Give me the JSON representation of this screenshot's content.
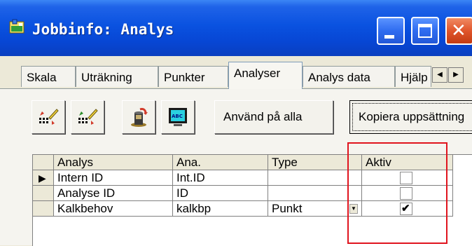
{
  "window": {
    "title": "Jobbinfo: Analys",
    "icon": "application-icon",
    "colors": {
      "titlebar": "#0a52e0",
      "close": "#e0552b"
    }
  },
  "tabs": [
    {
      "label": "Skala"
    },
    {
      "label": "Uträkning"
    },
    {
      "label": "Punkter"
    },
    {
      "label": "Analyser",
      "active": true
    },
    {
      "label": "Analys data"
    },
    {
      "label": "Hjälp"
    }
  ],
  "toolbar": {
    "icons": [
      "edit-add-icon",
      "edit-remove-icon",
      "import-icon",
      "spellcheck-monitor-icon"
    ],
    "apply_all": "Använd på alla",
    "copy_setup": "Kopiera uppsättning"
  },
  "grid": {
    "columns": [
      "Analys",
      "Ana.",
      "Type",
      "Aktiv"
    ],
    "rows": [
      {
        "analys": "Intern ID",
        "ana": "Int.ID",
        "type": "",
        "aktiv": false,
        "current": true
      },
      {
        "analys": "Analyse ID",
        "ana": "ID",
        "type": "",
        "aktiv": false
      },
      {
        "analys": "Kalkbehov",
        "ana": "kalkbp",
        "type": "Punkt",
        "aktiv": true
      }
    ]
  },
  "annotation": {
    "color": "#e0141e"
  }
}
